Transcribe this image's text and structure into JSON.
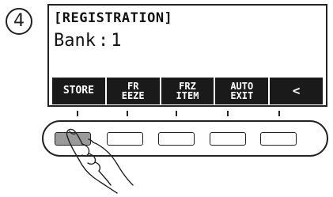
{
  "step": {
    "number": "4"
  },
  "display": {
    "title": "[REGISTRATION]",
    "bank_label": "Bank",
    "bank_value": "1",
    "softkeys": [
      {
        "lines": [
          "STORE"
        ]
      },
      {
        "lines": [
          "FR",
          "EEZE"
        ]
      },
      {
        "lines": [
          "FRZ",
          "ITEM"
        ]
      },
      {
        "lines": [
          "AUTO",
          "EXIT"
        ]
      },
      {
        "lines": [
          "<"
        ]
      }
    ]
  },
  "panel": {
    "buttons": [
      {
        "name": "store",
        "pressed": true
      },
      {
        "name": "freeze",
        "pressed": false
      },
      {
        "name": "frz-item",
        "pressed": false
      },
      {
        "name": "auto-exit",
        "pressed": false
      },
      {
        "name": "back",
        "pressed": false
      }
    ]
  },
  "icons": {
    "hand": "pointing-hand-icon"
  }
}
